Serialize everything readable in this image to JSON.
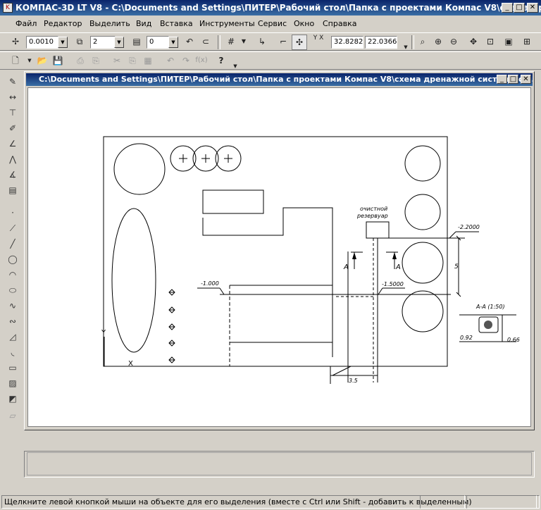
{
  "app": {
    "title": "КОМПАС-3D LT V8 - C:\\Documents and Settings\\ПИТЕР\\Рабочий стол\\Папка с проектами Компас V8\\схема дренажно...",
    "icon_glyph": "K"
  },
  "window_controls": {
    "minimize": "_",
    "maximize": "□",
    "close": "✕"
  },
  "menu": {
    "items": [
      "Файл",
      "Редактор",
      "Выделить",
      "Вид",
      "Вставка",
      "Инструменты",
      "Сервис",
      "Окно",
      "Справка"
    ]
  },
  "toolbar1": {
    "scale_value": "0.0010",
    "layer_value": "2",
    "style_value": "0",
    "coord_x": "32.8282",
    "coord_y": "22.0366",
    "coord_label": "Y X"
  },
  "document": {
    "title": "C:\\Documents and Settings\\ПИТЕР\\Рабочий стол\\Папка с проектами Компас V8\\схема дренажной системы.cd..."
  },
  "drawing": {
    "label_reservoir_1": "очистной",
    "label_reservoir_2": "резервуар",
    "dim_2200": "-2.2000",
    "dim_1000": "-1.000",
    "dim_15000": "-1.5000",
    "dim_5": "5",
    "dim_35": "3.5",
    "section_label": "А-А (1:50)",
    "dim_092": "0.92",
    "dim_066": "0.66",
    "marker_a": "А",
    "axis_y": "Y",
    "axis_x": "X"
  },
  "status": {
    "hint": "Щелкните левой кнопкой мыши на объекте для его выделения (вместе с Ctrl или Shift - добавить к выделенным)"
  }
}
